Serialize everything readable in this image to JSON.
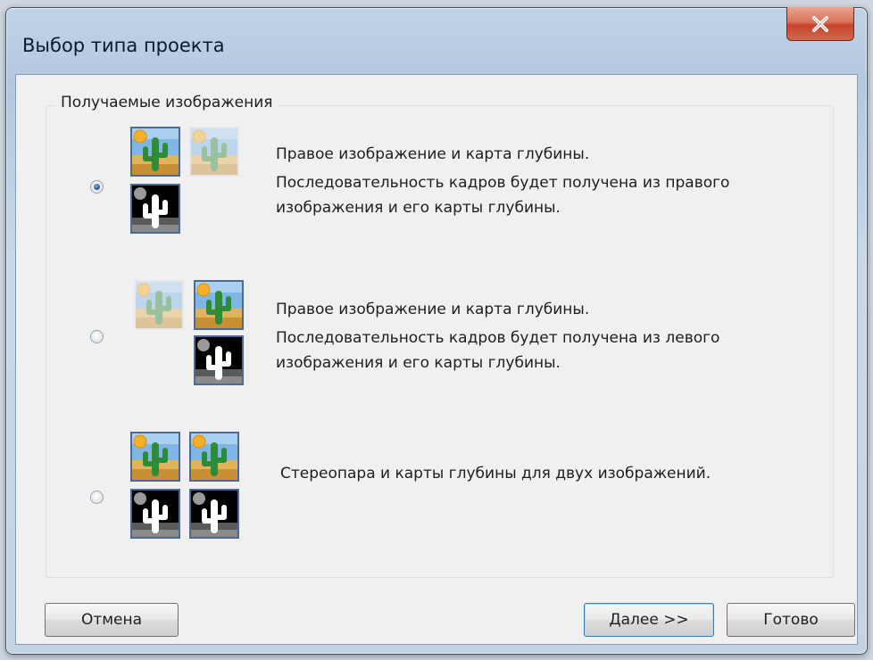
{
  "window": {
    "title": "Выбор типа проекта"
  },
  "group": {
    "label": "Получаемые изображения"
  },
  "options": [
    {
      "checked": true,
      "line1": "Правое изображение и карта глубины.",
      "line2": "Последовательность кадров будет получена из правого",
      "line3": "изображения и его карты глубины."
    },
    {
      "checked": false,
      "line1": "Правое изображение и карта глубины.",
      "line2": "Последовательность кадров будет получена из левого",
      "line3": "изображения и его карты глубины."
    },
    {
      "checked": false,
      "line1": "Стереопара и карты глубины для двух изображений."
    }
  ],
  "buttons": {
    "cancel": "Отмена",
    "next": "Далее >>",
    "finish": "Готово"
  },
  "icons": {
    "close": "close-icon",
    "photo": "cactus-photo-icon",
    "depth": "cactus-depth-map-icon"
  }
}
